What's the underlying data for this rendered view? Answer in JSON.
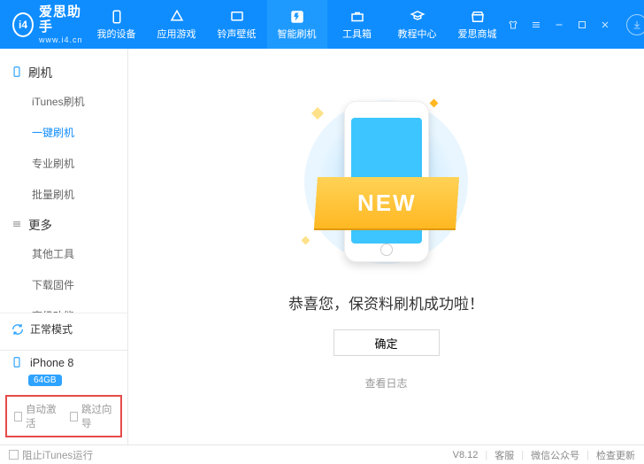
{
  "brand": {
    "name": "爱思助手",
    "url": "www.i4.cn",
    "logo_text": "i4"
  },
  "nav": [
    {
      "label": "我的设备",
      "icon": "device-icon"
    },
    {
      "label": "应用游戏",
      "icon": "apps-icon"
    },
    {
      "label": "铃声壁纸",
      "icon": "media-icon"
    },
    {
      "label": "智能刷机",
      "icon": "flash-icon",
      "active": true
    },
    {
      "label": "工具箱",
      "icon": "toolbox-icon"
    },
    {
      "label": "教程中心",
      "icon": "tutorial-icon"
    },
    {
      "label": "爱思商城",
      "icon": "shop-icon"
    }
  ],
  "sidebar": {
    "cat1": {
      "label": "刷机",
      "items": [
        "iTunes刷机",
        "一键刷机",
        "专业刷机",
        "批量刷机"
      ],
      "active_index": 1
    },
    "cat2": {
      "label": "更多",
      "items": [
        "其他工具",
        "下载固件",
        "高级功能"
      ]
    }
  },
  "mode": {
    "label": "正常模式"
  },
  "device": {
    "name": "iPhone 8",
    "storage": "64GB"
  },
  "checks": {
    "auto_activate": "自动激活",
    "skip_guide": "跳过向导"
  },
  "main": {
    "ribbon": "NEW",
    "message": "恭喜您，保资料刷机成功啦！",
    "ok": "确定",
    "log": "查看日志"
  },
  "status": {
    "block_itunes": "阻止iTunes运行",
    "version": "V8.12",
    "support": "客服",
    "wechat": "微信公众号",
    "update": "检查更新"
  }
}
